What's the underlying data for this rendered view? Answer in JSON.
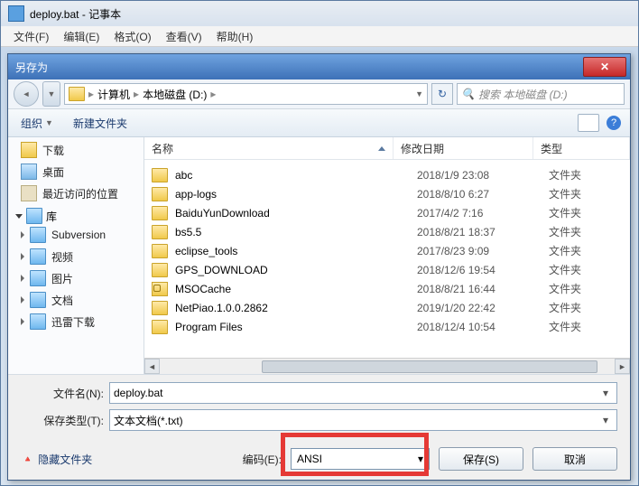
{
  "notepad": {
    "title": "deploy.bat - 记事本",
    "menu": [
      "文件(F)",
      "编辑(E)",
      "格式(O)",
      "查看(V)",
      "帮助(H)"
    ]
  },
  "dialog": {
    "title": "另存为",
    "nav": {
      "back": "◄",
      "fwd": "▼"
    },
    "breadcrumb": {
      "computer": "计算机",
      "drive": "本地磁盘 (D:)"
    },
    "search_placeholder": "搜索 本地磁盘 (D:)",
    "toolbar": {
      "organize": "组织",
      "newfolder": "新建文件夹"
    },
    "columns": {
      "name": "名称",
      "date": "修改日期",
      "type": "类型"
    },
    "sidebar": {
      "downloads": "下载",
      "desktop": "桌面",
      "recent": "最近访问的位置",
      "libraries": "库",
      "subversion": "Subversion",
      "videos": "视频",
      "pictures": "图片",
      "documents": "文档",
      "xunlei": "迅雷下载"
    },
    "files": [
      {
        "name": "abc",
        "date": "2018/1/9 23:08",
        "type": "文件夹",
        "lock": false
      },
      {
        "name": "app-logs",
        "date": "2018/8/10 6:27",
        "type": "文件夹",
        "lock": false
      },
      {
        "name": "BaiduYunDownload",
        "date": "2017/4/2 7:16",
        "type": "文件夹",
        "lock": false
      },
      {
        "name": "bs5.5",
        "date": "2018/8/21 18:37",
        "type": "文件夹",
        "lock": false
      },
      {
        "name": "eclipse_tools",
        "date": "2017/8/23 9:09",
        "type": "文件夹",
        "lock": false
      },
      {
        "name": "GPS_DOWNLOAD",
        "date": "2018/12/6 19:54",
        "type": "文件夹",
        "lock": false
      },
      {
        "name": "MSOCache",
        "date": "2018/8/21 16:44",
        "type": "文件夹",
        "lock": true
      },
      {
        "name": "NetPiao.1.0.0.2862",
        "date": "2019/1/20 22:42",
        "type": "文件夹",
        "lock": false
      },
      {
        "name": "Program Files",
        "date": "2018/12/4 10:54",
        "type": "文件夹",
        "lock": false
      }
    ],
    "filename_label": "文件名(N):",
    "filename_value": "deploy.bat",
    "filetype_label": "保存类型(T):",
    "filetype_value": "文本文档(*.txt)",
    "hide_folders": "隐藏文件夹",
    "encoding_label": "编码(E):",
    "encoding_value": "ANSI",
    "save_btn": "保存(S)",
    "cancel_btn": "取消"
  }
}
